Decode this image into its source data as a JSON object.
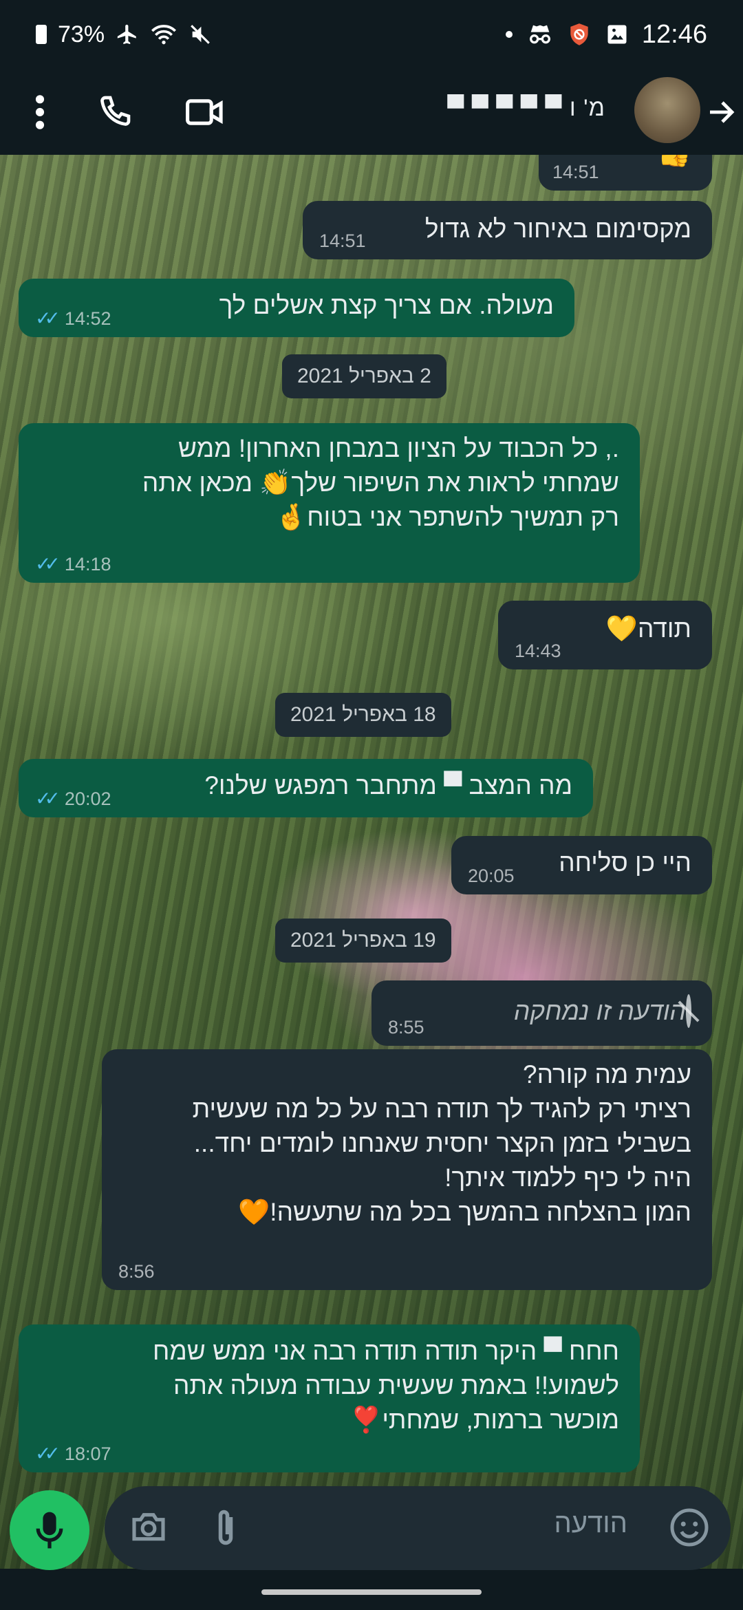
{
  "status_bar": {
    "battery": "73%",
    "time": "12:46",
    "icons": [
      "battery-icon",
      "airplane-icon",
      "wifi-icon",
      "mute-icon",
      "dot-icon",
      "incognito-icon",
      "shield-icon",
      "gallery-icon"
    ]
  },
  "header": {
    "contact_name": "מ' ו ▀ ▀ ▀ ▀ ▀",
    "icons": [
      "more-vert-icon",
      "phone-icon",
      "video-icon",
      "arrow-forward-icon"
    ]
  },
  "messages": [
    {
      "dir": "in",
      "text": "",
      "time": "14:51",
      "emoji": "👍"
    },
    {
      "dir": "in",
      "text": "מקסימום באיחור לא גדול",
      "time": "14:51"
    },
    {
      "dir": "out",
      "text": "מעולה. אם צריך קצת אשלים לך",
      "time": "14:52",
      "ticks": "✓✓"
    },
    {
      "dir": "date",
      "text": "2 באפריל 2021"
    },
    {
      "dir": "out",
      "lines": [
        "., כל הכבוד על הציון במבחן האחרון! ממש",
        "שמחתי לראות את השיפור שלך👏 מכאן אתה",
        "רק תמשיך להשתפר אני בטוח🤞"
      ],
      "time": "14:18",
      "ticks": "✓✓"
    },
    {
      "dir": "in",
      "text": "תודה💛",
      "time": "14:43"
    },
    {
      "dir": "date",
      "text": "18 באפריל 2021"
    },
    {
      "dir": "out",
      "text": "מה המצב ▀ מתחבר רמפגש שלנו?",
      "time": "20:02",
      "ticks": "✓✓"
    },
    {
      "dir": "in",
      "text": "היי כן סליחה",
      "time": "20:05"
    },
    {
      "dir": "date",
      "text": "19 באפריל 2021"
    },
    {
      "dir": "in",
      "text": "הודעה זו נמחקה",
      "time": "8:55",
      "deleted": true
    },
    {
      "dir": "in",
      "lines": [
        "עמית מה קורה?",
        "רציתי רק להגיד לך תודה רבה על כל מה שעשית",
        "בשבילי בזמן הקצר יחסית שאנחנו לומדים יחד...",
        "היה לי כיף ללמוד איתך!",
        "המון בהצלחה בהמשך בכל מה שתעשה!🧡"
      ],
      "time": "8:56"
    },
    {
      "dir": "out",
      "lines": [
        "חחח ▀ היקר תודה תודה רבה אני ממש שמח",
        "לשמוע!! באמת שעשית עבודה מעולה אתה",
        "מוכשר ברמות, שמחתי❣️"
      ],
      "time": "18:07",
      "ticks": "✓✓"
    }
  ],
  "composer": {
    "placeholder": "הודעה",
    "icons": [
      "emoji-icon",
      "attach-icon",
      "camera-icon",
      "mic-icon"
    ]
  },
  "colors": {
    "incoming_bubble": "#1f2c34",
    "outgoing_bubble": "#0b5c43",
    "read_ticks": "#53bdeb",
    "mic_button": "#21c063",
    "top_bar": "#0f1a1f"
  }
}
